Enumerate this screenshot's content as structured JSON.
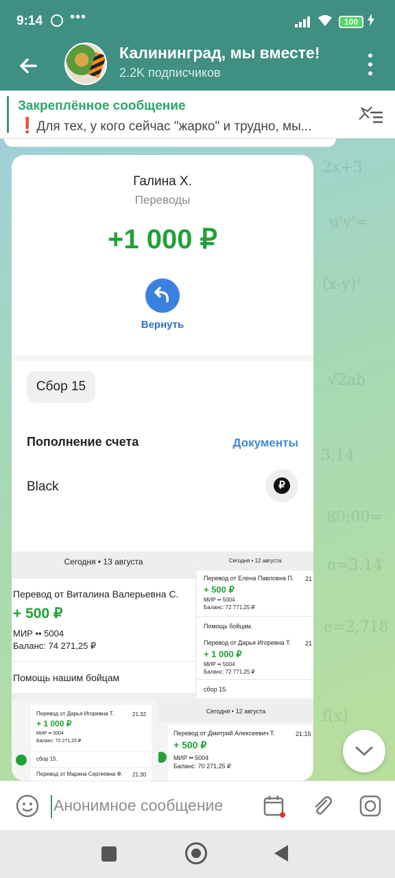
{
  "status_bar": {
    "time": "9:14",
    "dots": "•••",
    "battery": "100"
  },
  "header": {
    "title": "Калининград, мы вместе!",
    "subscribers": "2.2K подписчиков"
  },
  "pinned": {
    "title": "Закреплённое сообщение",
    "icon": "❗",
    "text": "Для тех, у кого сейчас \"жарко\" и трудно, мы..."
  },
  "receipt": {
    "payer": "Галина Х.",
    "category": "Переводы",
    "amount": "+1 000 ₽",
    "return_label": "Вернуть",
    "chip": "Сбор 15",
    "refill_title": "Пополнение счета",
    "documents_link": "Документы",
    "account": "Black",
    "ruble_glyph": "₽"
  },
  "collage": {
    "panel_a": {
      "date": "Сегодня • 13 августа",
      "title": "Перевод от Виталина Валерьевна С.",
      "amount": "+ 500 ₽",
      "card": "МИР •• 5004",
      "balance": "Баланс: 74 271,25 ₽",
      "comment": "Помощь нашим бойцам"
    },
    "panel_b": {
      "date": "Сегодня • 12 августа",
      "t1_title": "Перевод от Елена Павловна П.",
      "t1_time": "21",
      "t1_amount": "+ 500 ₽",
      "t1_card": "МИР •• 5004",
      "t1_balance": "Баланс: 72 771,25 ₽",
      "t1_comment": "Помощь бойцам.",
      "t2_title": "Перевод от Дарья Игоревна Т.",
      "t2_time": "21",
      "t2_amount": "+ 1 000 ₽",
      "t2_card": "МИР •• 5004",
      "t2_balance": "Баланс: 72 771,25 ₽",
      "t2_comment": "сбор 15."
    },
    "panel_c": {
      "t1_title": "Перевод от Дарья Игоревна Т.",
      "t1_time": "21:32",
      "t1_amount": "+ 1 000 ₽",
      "t1_card": "МИР •• 5004",
      "t1_balance": "Баланс: 72 271,25 ₽",
      "t1_comment": "сбор 15.",
      "t2_title": "Перевод от Марина Сергеевна Ф.",
      "t2_time": "21:30"
    },
    "panel_d": {
      "date": "Сегодня • 12 августа",
      "title": "Перевод от Дмитрий Алексеевич Т.",
      "time": "21:15",
      "amount": "+ 500 ₽",
      "card": "МИР •• 5004",
      "balance": "Баланс: 70 271,25 ₽"
    }
  },
  "input": {
    "placeholder": "Анонимное сообщение"
  },
  "colors": {
    "header": "#3f8f82",
    "accent_green": "#21a038",
    "link_blue": "#3a8bd6"
  }
}
